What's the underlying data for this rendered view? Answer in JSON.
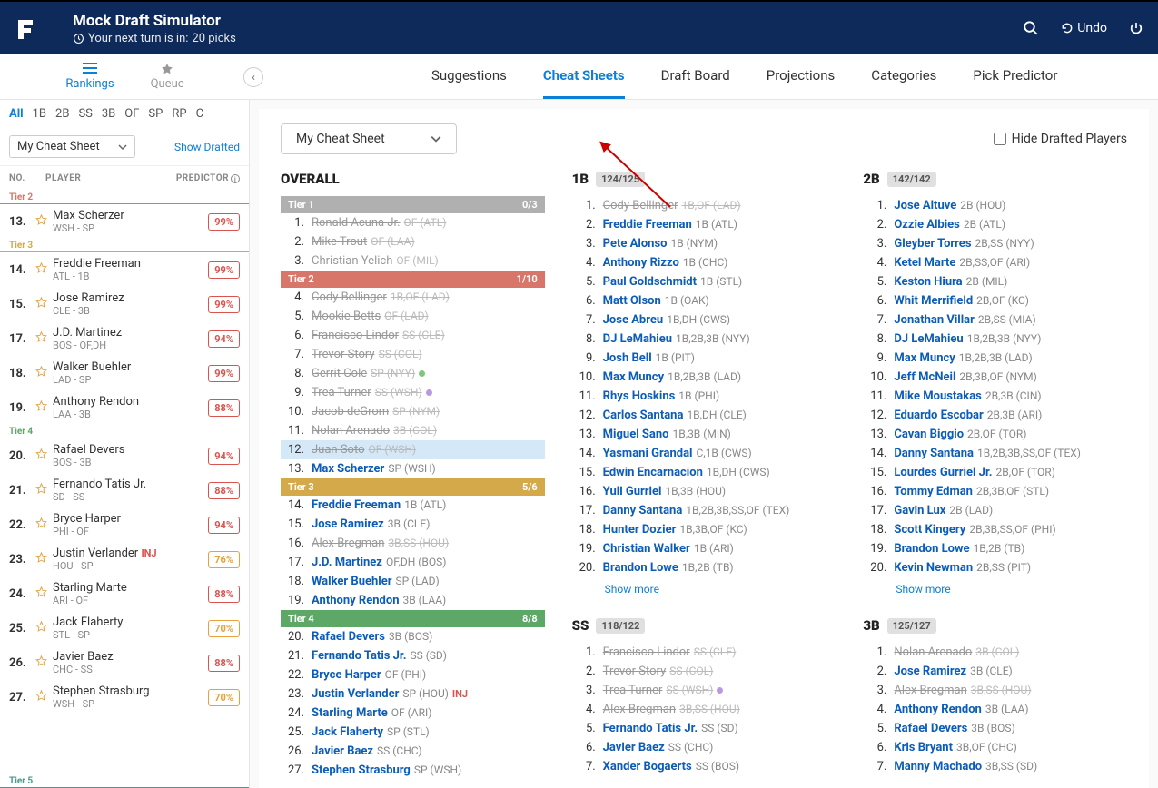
{
  "header": {
    "title": "Mock Draft Simulator",
    "subtitle_prefix": "Your next turn is in:",
    "subtitle_count": "20 picks",
    "undo": "Undo"
  },
  "sidebar_tabs": [
    {
      "label": "Rankings",
      "active": true
    },
    {
      "label": "Queue",
      "active": false
    }
  ],
  "content_tabs": [
    {
      "label": "Suggestions",
      "active": false
    },
    {
      "label": "Cheat Sheets",
      "active": true
    },
    {
      "label": "Draft Board",
      "active": false
    },
    {
      "label": "Projections",
      "active": false
    },
    {
      "label": "Categories",
      "active": false
    },
    {
      "label": "Pick Predictor",
      "active": false
    }
  ],
  "pos_filters": [
    "All",
    "1B",
    "2B",
    "SS",
    "3B",
    "OF",
    "SP",
    "RP",
    "C"
  ],
  "sidebar": {
    "sheet_select": "My Cheat Sheet",
    "show_drafted": "Show Drafted",
    "headers": {
      "no": "NO.",
      "player": "PLAYER",
      "predictor": "PREDICTOR"
    }
  },
  "tiers": {
    "tier2": "Tier 2",
    "tier3": "Tier 3",
    "tier4": "Tier 4",
    "tier5": "Tier 5"
  },
  "players_t2": [
    {
      "num": "13.",
      "name": "Max Scherzer",
      "meta": "WSH - SP",
      "pct": "99%",
      "cls": "p99"
    }
  ],
  "players_t3": [
    {
      "num": "14.",
      "name": "Freddie Freeman",
      "meta": "ATL - 1B",
      "pct": "99%",
      "cls": "p99"
    },
    {
      "num": "15.",
      "name": "Jose Ramirez",
      "meta": "CLE - 3B",
      "pct": "99%",
      "cls": "p99"
    },
    {
      "num": "17.",
      "name": "J.D. Martinez",
      "meta": "BOS - OF,DH",
      "pct": "94%",
      "cls": "p94"
    },
    {
      "num": "18.",
      "name": "Walker Buehler",
      "meta": "LAD - SP",
      "pct": "99%",
      "cls": "p99"
    },
    {
      "num": "19.",
      "name": "Anthony Rendon",
      "meta": "LAA - 3B",
      "pct": "88%",
      "cls": "p88"
    }
  ],
  "players_t4": [
    {
      "num": "20.",
      "name": "Rafael Devers",
      "meta": "BOS - 3B",
      "pct": "94%",
      "cls": "p94"
    },
    {
      "num": "21.",
      "name": "Fernando Tatis Jr.",
      "meta": "SD - SS",
      "pct": "88%",
      "cls": "p88"
    },
    {
      "num": "22.",
      "name": "Bryce Harper",
      "meta": "PHI - OF",
      "pct": "94%",
      "cls": "p94"
    },
    {
      "num": "23.",
      "name": "Justin Verlander",
      "meta": "HOU - SP",
      "pct": "76%",
      "cls": "p76",
      "inj": "INJ"
    },
    {
      "num": "24.",
      "name": "Starling Marte",
      "meta": "ARI - OF",
      "pct": "88%",
      "cls": "p88"
    },
    {
      "num": "25.",
      "name": "Jack Flaherty",
      "meta": "STL - SP",
      "pct": "70%",
      "cls": "p70"
    },
    {
      "num": "26.",
      "name": "Javier Baez",
      "meta": "CHC - SS",
      "pct": "88%",
      "cls": "p88"
    },
    {
      "num": "27.",
      "name": "Stephen Strasburg",
      "meta": "WSH - SP",
      "pct": "70%",
      "cls": "p70"
    }
  ],
  "content": {
    "sheet_select": "My Cheat Sheet",
    "hide_drafted": "Hide Drafted Players",
    "show_more": "Show more"
  },
  "overall": {
    "heading": "OVERALL",
    "tier1": {
      "label": "Tier 1",
      "count": "0/3"
    },
    "tier2": {
      "label": "Tier 2",
      "count": "1/10"
    },
    "tier3": {
      "label": "Tier 3",
      "count": "5/6"
    },
    "tier4": {
      "label": "Tier 4",
      "count": "8/8"
    },
    "t1_rows": [
      {
        "n": "1.",
        "name": "Ronald Acuna Jr.",
        "pos": "OF (ATL)",
        "d": true
      },
      {
        "n": "2.",
        "name": "Mike Trout",
        "pos": "OF (LAA)",
        "d": true
      },
      {
        "n": "3.",
        "name": "Christian Yelich",
        "pos": "OF (MIL)",
        "d": true
      }
    ],
    "t2_rows": [
      {
        "n": "4.",
        "name": "Cody Bellinger",
        "pos": "1B,OF (LAD)",
        "d": true
      },
      {
        "n": "5.",
        "name": "Mookie Betts",
        "pos": "OF (LAD)",
        "d": true
      },
      {
        "n": "6.",
        "name": "Francisco Lindor",
        "pos": "SS (CLE)",
        "d": true
      },
      {
        "n": "7.",
        "name": "Trevor Story",
        "pos": "SS (COL)",
        "d": true
      },
      {
        "n": "8.",
        "name": "Gerrit Cole",
        "pos": "SP (NYY)",
        "d": true,
        "dot": "green"
      },
      {
        "n": "9.",
        "name": "Trea Turner",
        "pos": "SS (WSH)",
        "d": true,
        "dot": "purple"
      },
      {
        "n": "10.",
        "name": "Jacob deGrom",
        "pos": "SP (NYM)",
        "d": true
      },
      {
        "n": "11.",
        "name": "Nolan Arenado",
        "pos": "3B (COL)",
        "d": true
      },
      {
        "n": "12.",
        "name": "Juan Soto",
        "pos": "OF (WSH)",
        "d": true,
        "hl": true
      },
      {
        "n": "13.",
        "name": "Max Scherzer",
        "pos": "SP (WSH)",
        "d": false
      }
    ],
    "t3_rows": [
      {
        "n": "14.",
        "name": "Freddie Freeman",
        "pos": "1B (ATL)",
        "d": false
      },
      {
        "n": "15.",
        "name": "Jose Ramirez",
        "pos": "3B (CLE)",
        "d": false
      },
      {
        "n": "16.",
        "name": "Alex Bregman",
        "pos": "3B,SS (HOU)",
        "d": true
      },
      {
        "n": "17.",
        "name": "J.D. Martinez",
        "pos": "OF,DH (BOS)",
        "d": false
      },
      {
        "n": "18.",
        "name": "Walker Buehler",
        "pos": "SP (LAD)",
        "d": false
      },
      {
        "n": "19.",
        "name": "Anthony Rendon",
        "pos": "3B (LAA)",
        "d": false
      }
    ],
    "t4_rows": [
      {
        "n": "20.",
        "name": "Rafael Devers",
        "pos": "3B (BOS)",
        "d": false
      },
      {
        "n": "21.",
        "name": "Fernando Tatis Jr.",
        "pos": "SS (SD)",
        "d": false
      },
      {
        "n": "22.",
        "name": "Bryce Harper",
        "pos": "OF (PHI)",
        "d": false
      },
      {
        "n": "23.",
        "name": "Justin Verlander",
        "pos": "SP (HOU)",
        "d": false,
        "inj": "INJ"
      },
      {
        "n": "24.",
        "name": "Starling Marte",
        "pos": "OF (ARI)",
        "d": false
      },
      {
        "n": "25.",
        "name": "Jack Flaherty",
        "pos": "SP (STL)",
        "d": false
      },
      {
        "n": "26.",
        "name": "Javier Baez",
        "pos": "SS (CHC)",
        "d": false
      },
      {
        "n": "27.",
        "name": "Stephen Strasburg",
        "pos": "SP (WSH)",
        "d": false
      }
    ]
  },
  "col_1b": {
    "heading": "1B",
    "count": "124/125",
    "rows": [
      {
        "n": "1.",
        "name": "Cody Bellinger",
        "pos": "1B,OF (LAD)",
        "d": true
      },
      {
        "n": "2.",
        "name": "Freddie Freeman",
        "pos": "1B (ATL)",
        "d": false
      },
      {
        "n": "3.",
        "name": "Pete Alonso",
        "pos": "1B (NYM)",
        "d": false
      },
      {
        "n": "4.",
        "name": "Anthony Rizzo",
        "pos": "1B (CHC)",
        "d": false
      },
      {
        "n": "5.",
        "name": "Paul Goldschmidt",
        "pos": "1B (STL)",
        "d": false
      },
      {
        "n": "6.",
        "name": "Matt Olson",
        "pos": "1B (OAK)",
        "d": false
      },
      {
        "n": "7.",
        "name": "Jose Abreu",
        "pos": "1B,DH (CWS)",
        "d": false
      },
      {
        "n": "8.",
        "name": "DJ LeMahieu",
        "pos": "1B,2B,3B (NYY)",
        "d": false
      },
      {
        "n": "9.",
        "name": "Josh Bell",
        "pos": "1B (PIT)",
        "d": false
      },
      {
        "n": "10.",
        "name": "Max Muncy",
        "pos": "1B,2B,3B (LAD)",
        "d": false
      },
      {
        "n": "11.",
        "name": "Rhys Hoskins",
        "pos": "1B (PHI)",
        "d": false
      },
      {
        "n": "12.",
        "name": "Carlos Santana",
        "pos": "1B,DH (CLE)",
        "d": false
      },
      {
        "n": "13.",
        "name": "Miguel Sano",
        "pos": "1B,3B (MIN)",
        "d": false
      },
      {
        "n": "14.",
        "name": "Yasmani Grandal",
        "pos": "C,1B (CWS)",
        "d": false
      },
      {
        "n": "15.",
        "name": "Edwin Encarnacion",
        "pos": "1B,DH (CWS)",
        "d": false
      },
      {
        "n": "16.",
        "name": "Yuli Gurriel",
        "pos": "1B,3B (HOU)",
        "d": false
      },
      {
        "n": "17.",
        "name": "Danny Santana",
        "pos": "1B,2B,3B,SS,OF (TEX)",
        "d": false
      },
      {
        "n": "18.",
        "name": "Hunter Dozier",
        "pos": "1B,3B,OF (KC)",
        "d": false
      },
      {
        "n": "19.",
        "name": "Christian Walker",
        "pos": "1B (ARI)",
        "d": false
      },
      {
        "n": "20.",
        "name": "Brandon Lowe",
        "pos": "1B,2B (TB)",
        "d": false
      }
    ]
  },
  "col_ss": {
    "heading": "SS",
    "count": "118/122",
    "rows": [
      {
        "n": "1.",
        "name": "Francisco Lindor",
        "pos": "SS (CLE)",
        "d": true
      },
      {
        "n": "2.",
        "name": "Trevor Story",
        "pos": "SS (COL)",
        "d": true
      },
      {
        "n": "3.",
        "name": "Trea Turner",
        "pos": "SS (WSH)",
        "d": true,
        "dot": "purple"
      },
      {
        "n": "4.",
        "name": "Alex Bregman",
        "pos": "3B,SS (HOU)",
        "d": true
      },
      {
        "n": "5.",
        "name": "Fernando Tatis Jr.",
        "pos": "SS (SD)",
        "d": false
      },
      {
        "n": "6.",
        "name": "Javier Baez",
        "pos": "SS (CHC)",
        "d": false
      },
      {
        "n": "7.",
        "name": "Xander Bogaerts",
        "pos": "SS (BOS)",
        "d": false
      }
    ]
  },
  "col_2b": {
    "heading": "2B",
    "count": "142/142",
    "rows": [
      {
        "n": "1.",
        "name": "Jose Altuve",
        "pos": "2B (HOU)",
        "d": false
      },
      {
        "n": "2.",
        "name": "Ozzie Albies",
        "pos": "2B (ATL)",
        "d": false
      },
      {
        "n": "3.",
        "name": "Gleyber Torres",
        "pos": "2B,SS (NYY)",
        "d": false
      },
      {
        "n": "4.",
        "name": "Ketel Marte",
        "pos": "2B,SS,OF (ARI)",
        "d": false
      },
      {
        "n": "5.",
        "name": "Keston Hiura",
        "pos": "2B (MIL)",
        "d": false
      },
      {
        "n": "6.",
        "name": "Whit Merrifield",
        "pos": "2B,OF (KC)",
        "d": false
      },
      {
        "n": "7.",
        "name": "Jonathan Villar",
        "pos": "2B,SS (MIA)",
        "d": false
      },
      {
        "n": "8.",
        "name": "DJ LeMahieu",
        "pos": "1B,2B,3B (NYY)",
        "d": false
      },
      {
        "n": "9.",
        "name": "Max Muncy",
        "pos": "1B,2B,3B (LAD)",
        "d": false
      },
      {
        "n": "10.",
        "name": "Jeff McNeil",
        "pos": "2B,3B,OF (NYM)",
        "d": false
      },
      {
        "n": "11.",
        "name": "Mike Moustakas",
        "pos": "2B,3B (CIN)",
        "d": false
      },
      {
        "n": "12.",
        "name": "Eduardo Escobar",
        "pos": "2B,3B (ARI)",
        "d": false
      },
      {
        "n": "13.",
        "name": "Cavan Biggio",
        "pos": "2B,OF (TOR)",
        "d": false
      },
      {
        "n": "14.",
        "name": "Danny Santana",
        "pos": "1B,2B,3B,SS,OF (TEX)",
        "d": false
      },
      {
        "n": "15.",
        "name": "Lourdes Gurriel Jr.",
        "pos": "2B,OF (TOR)",
        "d": false
      },
      {
        "n": "16.",
        "name": "Tommy Edman",
        "pos": "2B,3B,OF (STL)",
        "d": false
      },
      {
        "n": "17.",
        "name": "Gavin Lux",
        "pos": "2B (LAD)",
        "d": false
      },
      {
        "n": "18.",
        "name": "Scott Kingery",
        "pos": "2B,3B,SS,OF (PHI)",
        "d": false
      },
      {
        "n": "19.",
        "name": "Brandon Lowe",
        "pos": "1B,2B (TB)",
        "d": false
      },
      {
        "n": "20.",
        "name": "Kevin Newman",
        "pos": "2B,SS (PIT)",
        "d": false
      }
    ]
  },
  "col_3b": {
    "heading": "3B",
    "count": "125/127",
    "rows": [
      {
        "n": "1.",
        "name": "Nolan Arenado",
        "pos": "3B (COL)",
        "d": true
      },
      {
        "n": "2.",
        "name": "Jose Ramirez",
        "pos": "3B (CLE)",
        "d": false
      },
      {
        "n": "3.",
        "name": "Alex Bregman",
        "pos": "3B,SS (HOU)",
        "d": true
      },
      {
        "n": "4.",
        "name": "Anthony Rendon",
        "pos": "3B (LAA)",
        "d": false
      },
      {
        "n": "5.",
        "name": "Rafael Devers",
        "pos": "3B (BOS)",
        "d": false
      },
      {
        "n": "6.",
        "name": "Kris Bryant",
        "pos": "3B,OF (CHC)",
        "d": false
      },
      {
        "n": "7.",
        "name": "Manny Machado",
        "pos": "3B,SS (SD)",
        "d": false
      }
    ]
  }
}
